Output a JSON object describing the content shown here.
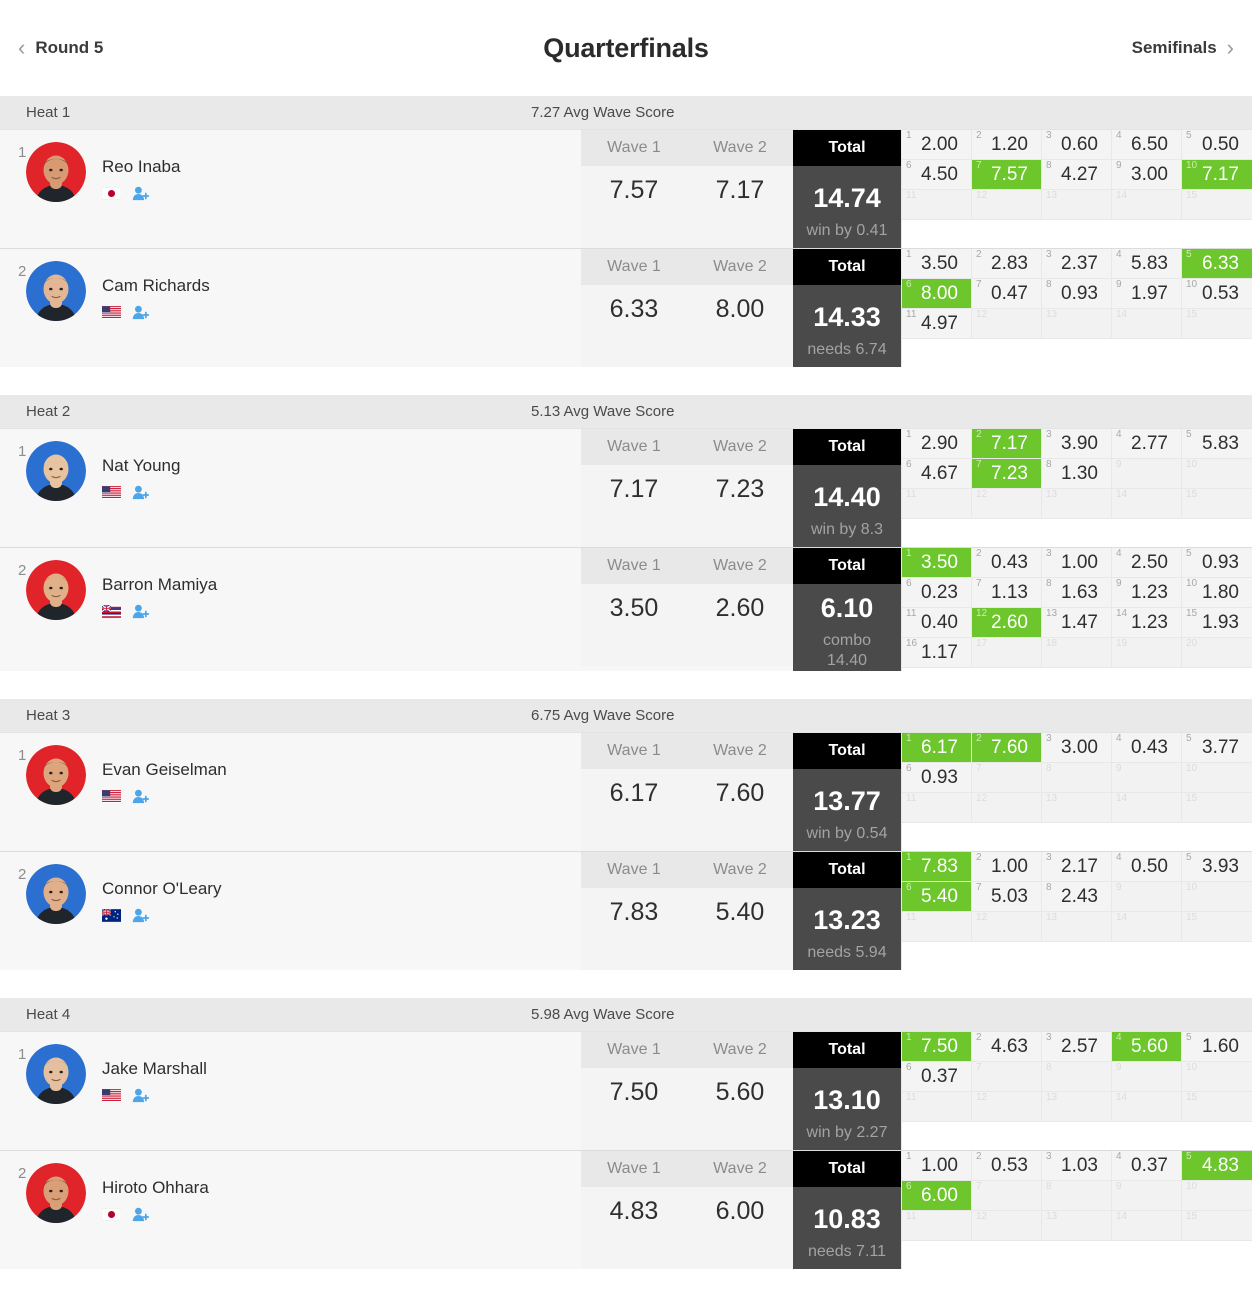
{
  "header": {
    "prev_label": "Round 5",
    "title": "Quarterfinals",
    "next_label": "Semifinals",
    "prev_icon": "chevron-left-icon",
    "next_icon": "chevron-right-icon"
  },
  "labels": {
    "wave1": "Wave 1",
    "wave2": "Wave 2",
    "total": "Total",
    "add_user_icon": "add-person-icon"
  },
  "colors": {
    "counted_green": "#6cc62c",
    "total_header": "#000000",
    "total_body": "#4a4a4a",
    "jersey_red": "#e0242a",
    "jersey_blue": "#2b6fd0"
  },
  "heats": [
    {
      "name": "Heat 1",
      "avg": "7.27 Avg Wave Score",
      "athletes": [
        {
          "seed": "1",
          "name": "Reo Inaba",
          "country": "JPN",
          "jersey": "#e0242a",
          "skin": "#d79a73",
          "hair": "#1b1613",
          "wave1": "7.57",
          "wave2": "7.17",
          "total": "14.74",
          "note": "win by 0.41",
          "waves": [
            "2.00",
            "1.20",
            "0.60",
            "6.50",
            "0.50",
            "4.50",
            "7.57",
            "4.27",
            "3.00",
            "7.17"
          ],
          "counted": [
            7,
            10
          ]
        },
        {
          "seed": "2",
          "name": "Cam Richards",
          "country": "USA",
          "jersey": "#2b6fd0",
          "skin": "#e3b795",
          "hair": "#6b5438",
          "wave1": "6.33",
          "wave2": "8.00",
          "total": "14.33",
          "note": "needs 6.74",
          "waves": [
            "3.50",
            "2.83",
            "2.37",
            "5.83",
            "6.33",
            "8.00",
            "0.47",
            "0.93",
            "1.97",
            "0.53",
            "4.97"
          ],
          "counted": [
            5,
            6
          ]
        }
      ]
    },
    {
      "name": "Heat 2",
      "avg": "5.13 Avg Wave Score",
      "athletes": [
        {
          "seed": "1",
          "name": "Nat Young",
          "country": "USA",
          "jersey": "#2b6fd0",
          "skin": "#e8c3a0",
          "hair": "#e8d9a8",
          "wave1": "7.17",
          "wave2": "7.23",
          "total": "14.40",
          "note": "win by 8.3",
          "waves": [
            "2.90",
            "7.17",
            "3.90",
            "2.77",
            "5.83",
            "4.67",
            "7.23",
            "1.30"
          ],
          "counted": [
            2,
            7
          ]
        },
        {
          "seed": "2",
          "name": "Barron Mamiya",
          "country": "HAW",
          "jersey": "#e0242a",
          "skin": "#e0b089",
          "hair": "#c27a3c",
          "wave1": "3.50",
          "wave2": "2.60",
          "total": "6.10",
          "note": "combo\n14.40",
          "waves": [
            "3.50",
            "0.43",
            "1.00",
            "2.50",
            "0.93",
            "0.23",
            "1.13",
            "1.63",
            "1.23",
            "1.80",
            "0.40",
            "2.60",
            "1.47",
            "1.23",
            "1.93",
            "1.17"
          ],
          "counted": [
            1,
            12
          ]
        }
      ]
    },
    {
      "name": "Heat 3",
      "avg": "6.75 Avg Wave Score",
      "athletes": [
        {
          "seed": "1",
          "name": "Evan Geiselman",
          "country": "USA",
          "jersey": "#e0242a",
          "skin": "#dda57c",
          "hair": "#4a3322",
          "wave1": "6.17",
          "wave2": "7.60",
          "total": "13.77",
          "note": "win by 0.54",
          "waves": [
            "6.17",
            "7.60",
            "3.00",
            "0.43",
            "3.77",
            "0.93"
          ],
          "counted": [
            1,
            2
          ]
        },
        {
          "seed": "2",
          "name": "Connor O'Leary",
          "country": "AUS",
          "jersey": "#2b6fd0",
          "skin": "#e0b08c",
          "hair": "#3a2a1c",
          "wave1": "7.83",
          "wave2": "5.40",
          "total": "13.23",
          "note": "needs 5.94",
          "waves": [
            "7.83",
            "1.00",
            "2.17",
            "0.50",
            "3.93",
            "5.40",
            "5.03",
            "2.43"
          ],
          "counted": [
            1,
            6
          ]
        }
      ]
    },
    {
      "name": "Heat 4",
      "avg": "5.98 Avg Wave Score",
      "athletes": [
        {
          "seed": "1",
          "name": "Jake Marshall",
          "country": "USA",
          "jersey": "#2b6fd0",
          "skin": "#e5c0a0",
          "hair": "#ab8f5f",
          "wave1": "7.50",
          "wave2": "5.60",
          "total": "13.10",
          "note": "win by 2.27",
          "waves": [
            "7.50",
            "4.63",
            "2.57",
            "5.60",
            "1.60",
            "0.37"
          ],
          "counted": [
            1,
            4
          ]
        },
        {
          "seed": "2",
          "name": "Hiroto Ohhara",
          "country": "JPN",
          "jersey": "#e0242a",
          "skin": "#d9a077",
          "hair": "#17120f",
          "wave1": "4.83",
          "wave2": "6.00",
          "total": "10.83",
          "note": "needs 7.11",
          "waves": [
            "1.00",
            "0.53",
            "1.03",
            "0.37",
            "4.83",
            "6.00"
          ],
          "counted": [
            5,
            6
          ]
        }
      ]
    }
  ]
}
